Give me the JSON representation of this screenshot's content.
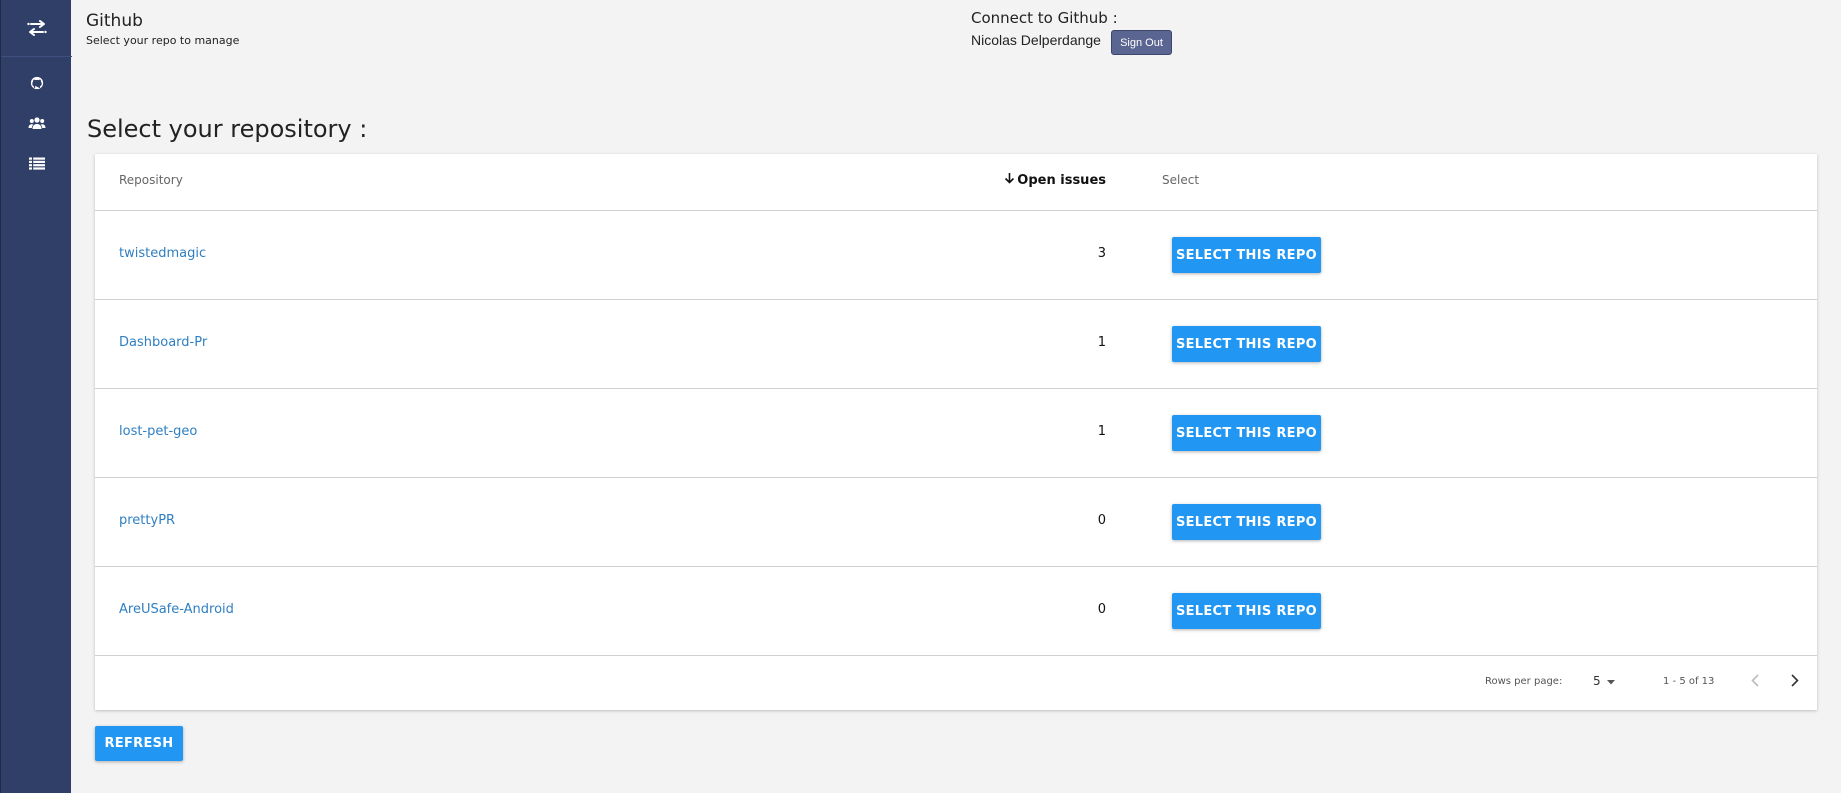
{
  "sidebar": {
    "logo_icon": "swap-arrows-icon",
    "items": [
      {
        "icon": "github-icon"
      },
      {
        "icon": "users-icon"
      },
      {
        "icon": "list-icon"
      }
    ]
  },
  "header": {
    "title": "Github",
    "subtitle": "Select your repo to manage"
  },
  "connect": {
    "label": "Connect to Github :",
    "user": "Nicolas Delperdange",
    "signout_label": "Sign Out"
  },
  "main": {
    "heading": "Select your repository :"
  },
  "table": {
    "columns": {
      "repository": "Repository",
      "open_issues": "Open issues",
      "select": "Select"
    },
    "sort_icon": "arrow-down-icon",
    "rows": [
      {
        "name": "twistedmagic",
        "issues": "3",
        "action": "SELECT THIS REPO"
      },
      {
        "name": "Dashboard-Pr",
        "issues": "1",
        "action": "SELECT THIS REPO"
      },
      {
        "name": "lost-pet-geo",
        "issues": "1",
        "action": "SELECT THIS REPO"
      },
      {
        "name": "prettyPR",
        "issues": "0",
        "action": "SELECT THIS REPO"
      },
      {
        "name": "AreUSafe-Android",
        "issues": "0",
        "action": "SELECT THIS REPO"
      }
    ],
    "pagination": {
      "rows_per_page_label": "Rows per page:",
      "rows_per_page_value": "5",
      "range": "1 - 5 of 13"
    }
  },
  "refresh_label": "REFRESH",
  "colors": {
    "sidebar": "#2f3f68",
    "primary": "#2196f3",
    "link": "#2f7fc2",
    "signout": "#5a6591",
    "background": "#f3f3f3"
  }
}
